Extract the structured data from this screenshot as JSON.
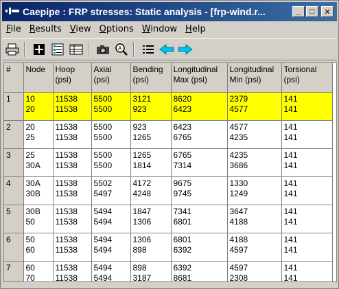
{
  "window": {
    "title": "Caepipe : FRP stresses: Static analysis -  [frp-wind.r...",
    "buttons": {
      "minimize": "_",
      "maximize": "□",
      "close": "✕"
    }
  },
  "menu": [
    {
      "label": "File",
      "mnemonic": "F",
      "rest": "ile"
    },
    {
      "label": "Results",
      "mnemonic": "R",
      "rest": "esults"
    },
    {
      "label": "View",
      "mnemonic": "V",
      "rest": "iew"
    },
    {
      "label": "Options",
      "mnemonic": "O",
      "rest": "ptions"
    },
    {
      "label": "Window",
      "mnemonic": "W",
      "rest": "indow"
    },
    {
      "label": "Help",
      "mnemonic": "H",
      "rest": "elp"
    }
  ],
  "toolbar": {
    "icons": [
      "printer-icon",
      "plus-box-icon",
      "list-view-icon",
      "table-view-icon",
      "camera-icon",
      "zoom-icon",
      "bullet-list-icon",
      "arrow-left-icon",
      "arrow-right-icon"
    ]
  },
  "colors": {
    "highlight": "#ffff00",
    "title_gradient_start": "#0a246a",
    "title_gradient_end": "#3a6ea5",
    "arrow": "#00bfff"
  },
  "table": {
    "headers": [
      {
        "l1": "#",
        "l2": ""
      },
      {
        "l1": "Node",
        "l2": ""
      },
      {
        "l1": "Hoop",
        "l2": "(psi)"
      },
      {
        "l1": "Axial",
        "l2": "(psi)"
      },
      {
        "l1": "Bending",
        "l2": "(psi)"
      },
      {
        "l1": "Longitudinal",
        "l2": "Max (psi)"
      },
      {
        "l1": "Longitudinal",
        "l2": "Min (psi)"
      },
      {
        "l1": "Torsional",
        "l2": "(psi)"
      }
    ],
    "rows": [
      {
        "num": "1",
        "highlight": true,
        "node": [
          "10",
          "20"
        ],
        "hoop": [
          "11538",
          "11538"
        ],
        "axial": [
          "5500",
          "5500"
        ],
        "bending": [
          "3121",
          "923"
        ],
        "lmax": [
          "8620",
          "6423"
        ],
        "lmin": [
          "2379",
          "4577"
        ],
        "tors": [
          "141",
          "141"
        ]
      },
      {
        "num": "2",
        "highlight": false,
        "node": [
          "20",
          "25"
        ],
        "hoop": [
          "11538",
          "11538"
        ],
        "axial": [
          "5500",
          "5500"
        ],
        "bending": [
          "923",
          "1265"
        ],
        "lmax": [
          "6423",
          "6765"
        ],
        "lmin": [
          "4577",
          "4235"
        ],
        "tors": [
          "141",
          "141"
        ]
      },
      {
        "num": "3",
        "highlight": false,
        "node": [
          "25",
          "30A"
        ],
        "hoop": [
          "11538",
          "11538"
        ],
        "axial": [
          "5500",
          "5500"
        ],
        "bending": [
          "1265",
          "1814"
        ],
        "lmax": [
          "6765",
          "7314"
        ],
        "lmin": [
          "4235",
          "3686"
        ],
        "tors": [
          "141",
          "141"
        ]
      },
      {
        "num": "4",
        "highlight": false,
        "node": [
          "30A",
          "30B"
        ],
        "hoop": [
          "11538",
          "11538"
        ],
        "axial": [
          "5502",
          "5497"
        ],
        "bending": [
          "4172",
          "4248"
        ],
        "lmax": [
          "9675",
          "9745"
        ],
        "lmin": [
          "1330",
          "1249"
        ],
        "tors": [
          "141",
          "141"
        ]
      },
      {
        "num": "5",
        "highlight": false,
        "node": [
          "30B",
          "50"
        ],
        "hoop": [
          "11538",
          "11538"
        ],
        "axial": [
          "5494",
          "5494"
        ],
        "bending": [
          "1847",
          "1306"
        ],
        "lmax": [
          "7341",
          "6801"
        ],
        "lmin": [
          "3647",
          "4188"
        ],
        "tors": [
          "141",
          "141"
        ]
      },
      {
        "num": "6",
        "highlight": false,
        "node": [
          "50",
          "60"
        ],
        "hoop": [
          "11538",
          "11538"
        ],
        "axial": [
          "5494",
          "5494"
        ],
        "bending": [
          "1306",
          "898"
        ],
        "lmax": [
          "6801",
          "6392"
        ],
        "lmin": [
          "4188",
          "4597"
        ],
        "tors": [
          "141",
          "141"
        ]
      },
      {
        "num": "7",
        "highlight": false,
        "node": [
          "60",
          "70"
        ],
        "hoop": [
          "11538",
          "11538"
        ],
        "axial": [
          "5494",
          "5494"
        ],
        "bending": [
          "898",
          "3187"
        ],
        "lmax": [
          "6392",
          "8681"
        ],
        "lmin": [
          "4597",
          "2308"
        ],
        "tors": [
          "141",
          "141"
        ]
      }
    ]
  }
}
